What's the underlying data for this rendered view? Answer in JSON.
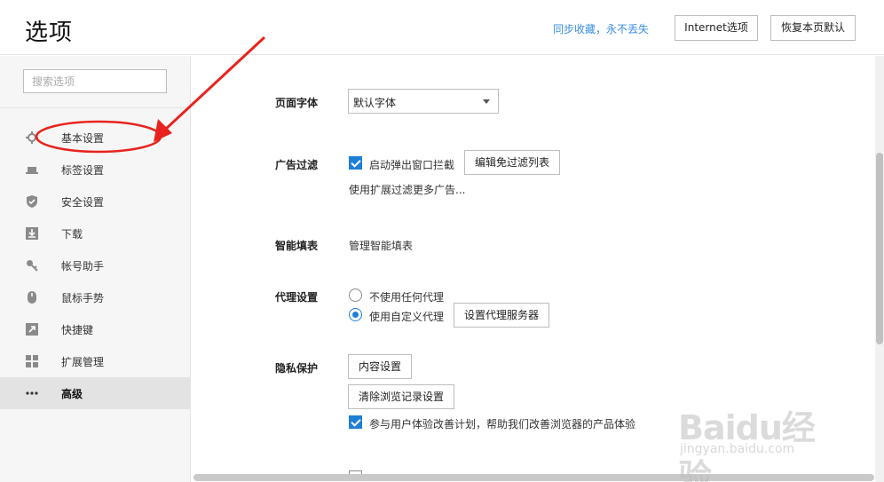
{
  "header": {
    "title": "选项",
    "sync_text": "同步收藏，永不丢失",
    "ie_button": "Internet选项",
    "restore_button": "恢复本页默认"
  },
  "sidebar": {
    "search_placeholder": "搜索选项",
    "items": [
      {
        "label": "基本设置",
        "icon": "gear-icon",
        "active": false
      },
      {
        "label": "标签设置",
        "icon": "tab-icon",
        "active": false
      },
      {
        "label": "安全设置",
        "icon": "shield-icon",
        "active": false
      },
      {
        "label": "下载",
        "icon": "download-icon",
        "active": false
      },
      {
        "label": "帐号助手",
        "icon": "key-icon",
        "active": false
      },
      {
        "label": "鼠标手势",
        "icon": "mouse-icon",
        "active": false
      },
      {
        "label": "快捷键",
        "icon": "shortcut-arrow-icon",
        "active": false
      },
      {
        "label": "扩展管理",
        "icon": "extensions-grid-icon",
        "active": false
      },
      {
        "label": "高级",
        "icon": "more-dots-icon",
        "active": true
      }
    ]
  },
  "main": {
    "font": {
      "label": "页面字体",
      "value": "默认字体"
    },
    "adblock": {
      "label": "广告过滤",
      "popup_block": "启动弹出窗口拦截",
      "popup_block_checked": true,
      "edit_button": "编辑免过滤列表",
      "more_link": "使用扩展过滤更多广告..."
    },
    "autofill": {
      "label": "智能填表",
      "link": "管理智能填表"
    },
    "proxy": {
      "label": "代理设置",
      "option_none": "不使用任何代理",
      "option_custom": "使用自定义代理",
      "selected": "custom",
      "button": "设置代理服务器"
    },
    "privacy": {
      "label": "隐私保护",
      "content_button": "内容设置",
      "clear_button": "清除浏览记录设置",
      "ux_text": "参与用户体验改善计划，帮助我们改善浏览器的产品体验",
      "ux_checked": true
    }
  },
  "watermark": {
    "brand": "Baidu经验",
    "url": "jingyan.baidu.com"
  },
  "colors": {
    "accent": "#1e7fd6",
    "link": "#3a8ee6",
    "annotation": "#e8231f",
    "active_nav": "#e3e3e3"
  }
}
